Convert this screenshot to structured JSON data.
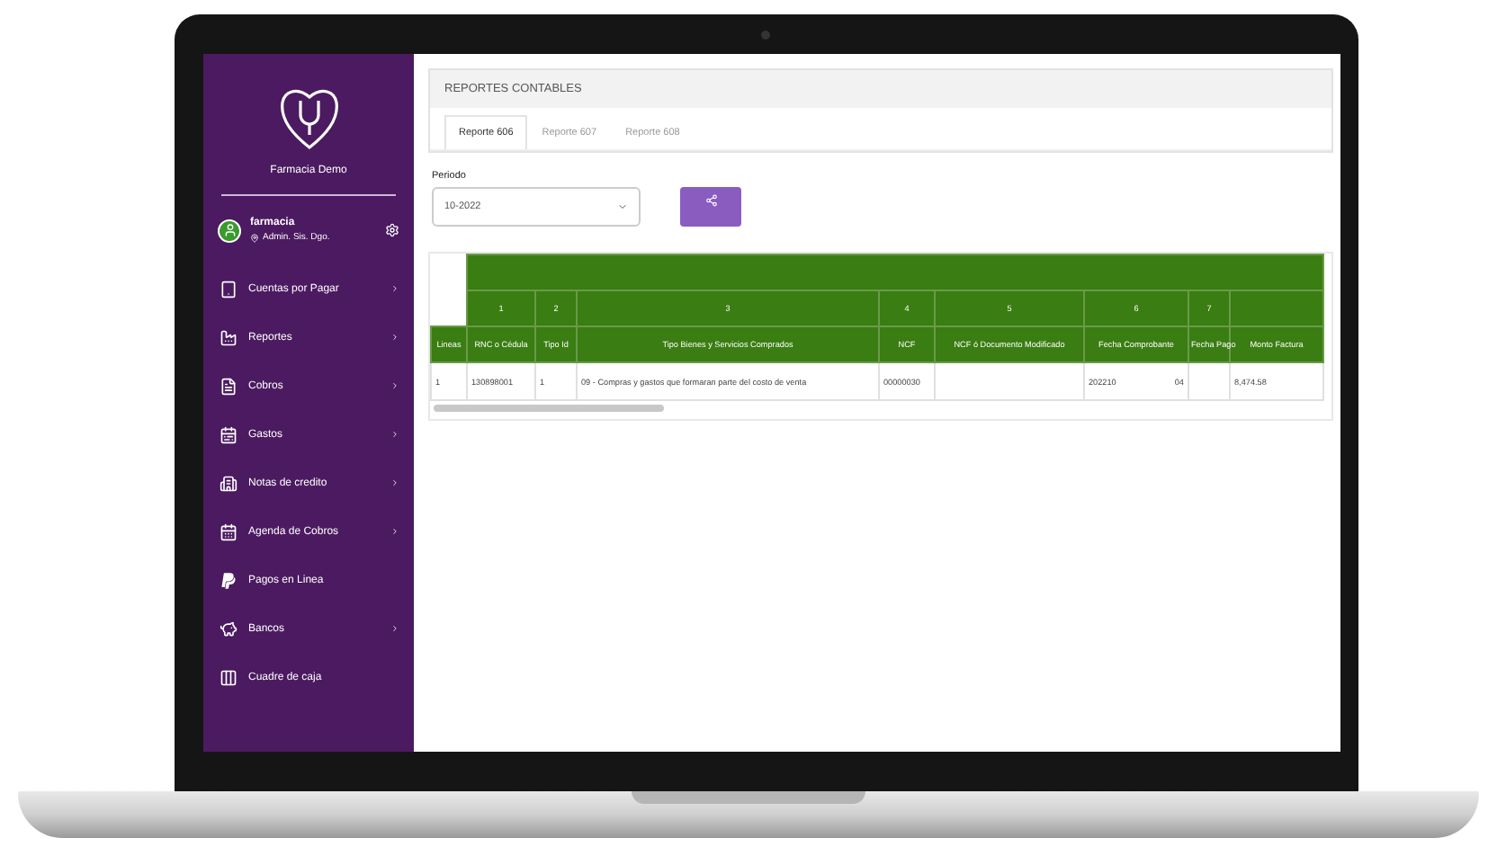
{
  "sidebar": {
    "brand": "Farmacia Demo",
    "user": {
      "name": "farmacia",
      "role": "Admin. Sis. Dgo."
    },
    "items": [
      {
        "label": "Cuentas por Pagar",
        "expandable": true
      },
      {
        "label": "Reportes",
        "expandable": true
      },
      {
        "label": "Cobros",
        "expandable": true
      },
      {
        "label": "Gastos",
        "expandable": true
      },
      {
        "label": "Notas de credito",
        "expandable": true
      },
      {
        "label": "Agenda de Cobros",
        "expandable": true
      },
      {
        "label": "Pagos en Linea",
        "expandable": false
      },
      {
        "label": "Bancos",
        "expandable": true
      },
      {
        "label": "Cuadre de caja",
        "expandable": false
      }
    ]
  },
  "page": {
    "title": "REPORTES CONTABLES",
    "tabs": [
      {
        "label": "Reporte 606",
        "selected": true
      },
      {
        "label": "Reporte 607",
        "selected": false
      },
      {
        "label": "Reporte 608",
        "selected": false
      }
    ],
    "period": {
      "label": "Periodo",
      "value": "10-2022"
    }
  },
  "table": {
    "group_headers": [
      "1",
      "2",
      "3",
      "4",
      "5",
      "6",
      "7"
    ],
    "columns": [
      "Lineas",
      "RNC o Cédula",
      "Tipo Id",
      "Tipo Bienes y Servicios Comprados",
      "NCF",
      "NCF ó Documento Modificado",
      "Fecha Comprobante",
      "Fecha Pago",
      "Monto Factura"
    ],
    "rows": [
      {
        "cells": [
          [
            "1"
          ],
          [
            "130898001"
          ],
          [
            "1"
          ],
          [
            "09 - Compras y gastos que formaran parte del costo de venta"
          ],
          [
            "00000030"
          ],
          [],
          [
            "202210",
            "04"
          ],
          [],
          [
            "8,474.58"
          ]
        ]
      }
    ]
  }
}
